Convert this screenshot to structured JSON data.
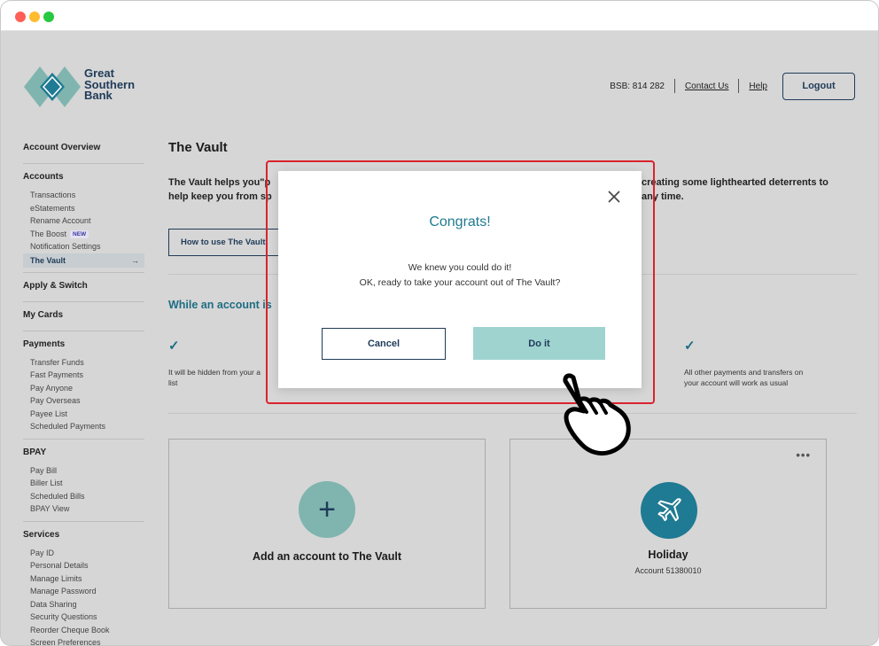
{
  "window": {
    "dots": [
      "close",
      "minimize",
      "maximize"
    ]
  },
  "brand": {
    "line1": "Great",
    "line2": "Southern",
    "line3": "Bank"
  },
  "header": {
    "bsb": "BSB: 814 282",
    "contact": "Contact Us",
    "help": "Help",
    "logout": "Logout"
  },
  "sidebar": {
    "account_overview": "Account Overview",
    "accounts": {
      "heading": "Accounts",
      "items": [
        "Transactions",
        "eStatements",
        "Rename Account",
        "The Boost",
        "Notification Settings",
        "The Vault"
      ],
      "new_badge": "NEW",
      "active_arrow": "→"
    },
    "apply_switch": "Apply & Switch",
    "my_cards": "My Cards",
    "payments": {
      "heading": "Payments",
      "items": [
        "Transfer Funds",
        "Fast Payments",
        "Pay Anyone",
        "Pay Overseas",
        "Payee List",
        "Scheduled Payments"
      ]
    },
    "bpay": {
      "heading": "BPAY",
      "items": [
        "Pay Bill",
        "Biller List",
        "Scheduled Bills",
        "BPAY View"
      ]
    },
    "services": {
      "heading": "Services",
      "items": [
        "Pay ID",
        "Personal Details",
        "Manage Limits",
        "Manage Password",
        "Data Sharing",
        "Security Questions",
        "Reorder Cheque Book",
        "Screen Preferences"
      ]
    }
  },
  "main": {
    "title": "The Vault",
    "intro_left_1": "The Vault helps you\"p",
    "intro_left_2": "help keep you from sp",
    "intro_right_1": "creating some lighthearted deterrents to",
    "intro_right_2": "any time.",
    "howto": "How to use The Vault",
    "while_heading": "While an account is",
    "feature_left": "It will be hidden from your a\nlist",
    "feature_right": "All other payments and transfers on\nyour account will work as usual",
    "check": "✓"
  },
  "cards": {
    "add": {
      "label": "Add an account to The Vault",
      "icon": "+"
    },
    "holiday": {
      "title": "Holiday",
      "account": "Account 51380010",
      "more": "•••"
    }
  },
  "modal": {
    "title": "Congrats!",
    "line1": "We knew you could do it!",
    "line2": "OK, ready to take your account out of The Vault?",
    "cancel": "Cancel",
    "confirm": "Do it"
  },
  "colors": {
    "brand_navy": "#1f3b58",
    "teal": "#1e7a8f",
    "highlight": "#d9232d",
    "do_it_button": "#9fd3d0"
  }
}
